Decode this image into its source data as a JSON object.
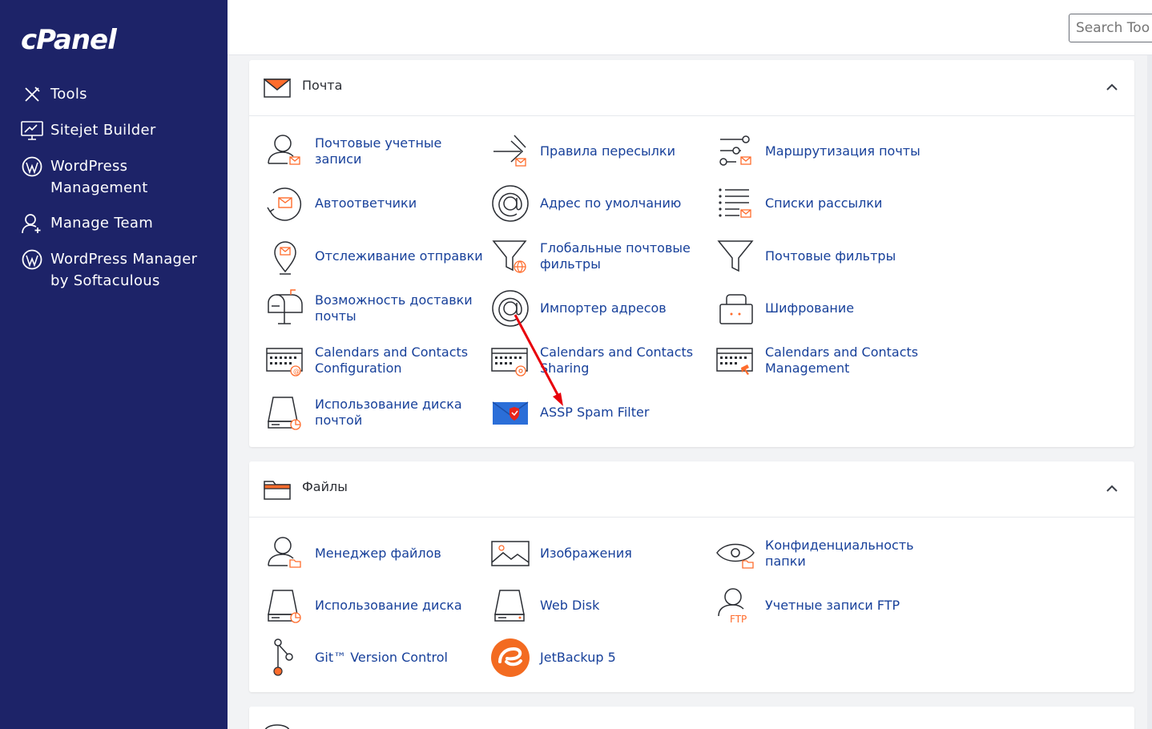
{
  "brand": {
    "logo": "cPanel"
  },
  "sidebar": {
    "items": [
      {
        "label": "Tools"
      },
      {
        "label": "Sitejet Builder"
      },
      {
        "label": "WordPress Management"
      },
      {
        "label": "Manage Team"
      },
      {
        "label": "WordPress Manager by Softaculous"
      }
    ]
  },
  "search": {
    "placeholder": "Search Tools"
  },
  "mail": {
    "title": "Почта",
    "items": [
      {
        "label": "Почтовые учетные записи"
      },
      {
        "label": "Правила пересылки"
      },
      {
        "label": "Маршрутизация почты"
      },
      {
        "label": "Автоответчики"
      },
      {
        "label": "Адрес по умолчанию"
      },
      {
        "label": "Списки рассылки"
      },
      {
        "label": "Отслеживание отправки"
      },
      {
        "label": "Глобальные почтовые фильтры"
      },
      {
        "label": "Почтовые фильтры"
      },
      {
        "label": "Возможность доставки почты"
      },
      {
        "label": "Импортер адресов"
      },
      {
        "label": "Шифрование"
      },
      {
        "label": "Calendars and Contacts Configuration"
      },
      {
        "label": "Calendars and Contacts Sharing"
      },
      {
        "label": "Calendars and Contacts Management"
      },
      {
        "label": "Использование диска почтой"
      },
      {
        "label": "ASSP Spam Filter"
      }
    ]
  },
  "files": {
    "title": "Файлы",
    "items": [
      {
        "label": "Менеджер файлов"
      },
      {
        "label": "Изображения"
      },
      {
        "label": "Конфиденциальность папки"
      },
      {
        "label": "Использование диска"
      },
      {
        "label": "Web Disk"
      },
      {
        "label": "Учетные записи FTP"
      },
      {
        "label": "Git™ Version Control"
      },
      {
        "label": "JetBackup 5"
      }
    ]
  },
  "colors": {
    "sidebar": "#1d2368",
    "link": "#17409a",
    "accent": "#ff6c2c",
    "annotation": "#e8000b"
  },
  "icons": [
    "tools-icon",
    "sitejet-icon",
    "wordpress-icon",
    "team-icon",
    "mail-icon",
    "folder-icon"
  ]
}
